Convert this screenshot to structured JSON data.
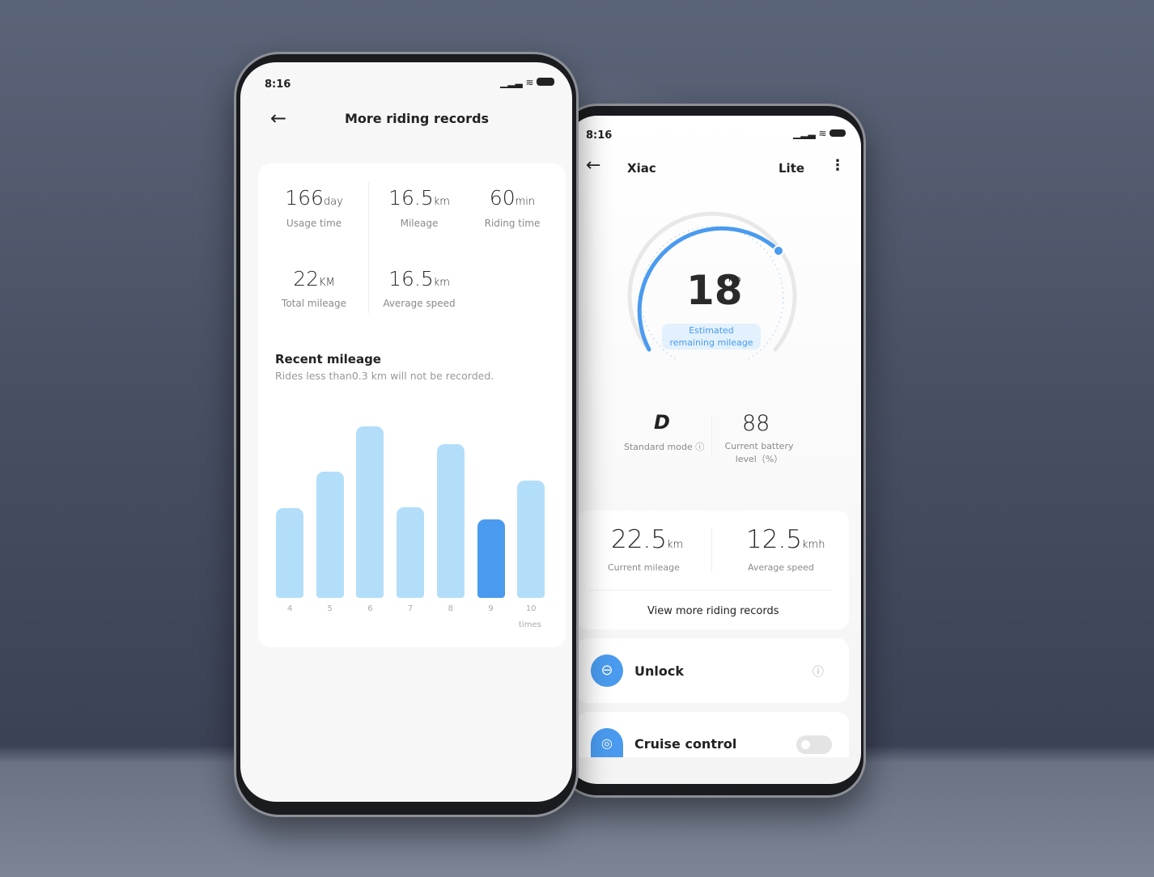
{
  "colors": {
    "accent": "#4a9bef",
    "bar": "#b3def9",
    "bar_highlight": "#4a9bef"
  },
  "left_phone": {
    "status": {
      "time": "8:16",
      "icons": [
        "signal-icon",
        "wifi-icon",
        "battery-icon"
      ]
    },
    "header": {
      "back_icon": "arrow-left-icon",
      "title": "More riding records"
    },
    "stats": [
      {
        "value": "166",
        "unit": "day",
        "label": "Usage time"
      },
      {
        "value": "16.5",
        "unit": "km",
        "label": "Mileage"
      },
      {
        "value": "60",
        "unit": "min",
        "label": "Riding time"
      },
      {
        "value": "22",
        "unit": "KM",
        "label": "Total mileage"
      },
      {
        "value": "16.5",
        "unit": "km",
        "label": "Average speed"
      }
    ],
    "recent": {
      "title": "Recent mileage",
      "subtitle": "Rides less than0.3 km will not be recorded."
    }
  },
  "chart_data": {
    "type": "bar",
    "categories": [
      "4",
      "5",
      "6",
      "7",
      "8",
      "9",
      "10"
    ],
    "values": [
      111,
      156,
      212,
      112,
      190,
      97,
      145
    ],
    "highlight_index": 5,
    "xlabel": "times",
    "grid": false
  },
  "right_phone": {
    "status": {
      "time": "8:16"
    },
    "header": {
      "title_left": "Xiac",
      "title_right": "Lite",
      "menu_icon": "more-vertical-icon"
    },
    "gauge": {
      "value": "18",
      "unit": "km",
      "label": "Estimated remaining mileage",
      "fraction": 0.72
    },
    "mode": {
      "value": "D",
      "label": "Standard mode"
    },
    "battery": {
      "value": "88",
      "label": "Current battery level（%）"
    },
    "ride": [
      {
        "value": "22.5",
        "unit": "km",
        "label": "Current mileage"
      },
      {
        "value": "12.5",
        "unit": "kmh",
        "label": "Average speed"
      }
    ],
    "view_more": "View more riding records",
    "unlock": {
      "label": "Unlock"
    },
    "cruise": {
      "label": "Cruise control",
      "enabled": false
    }
  }
}
